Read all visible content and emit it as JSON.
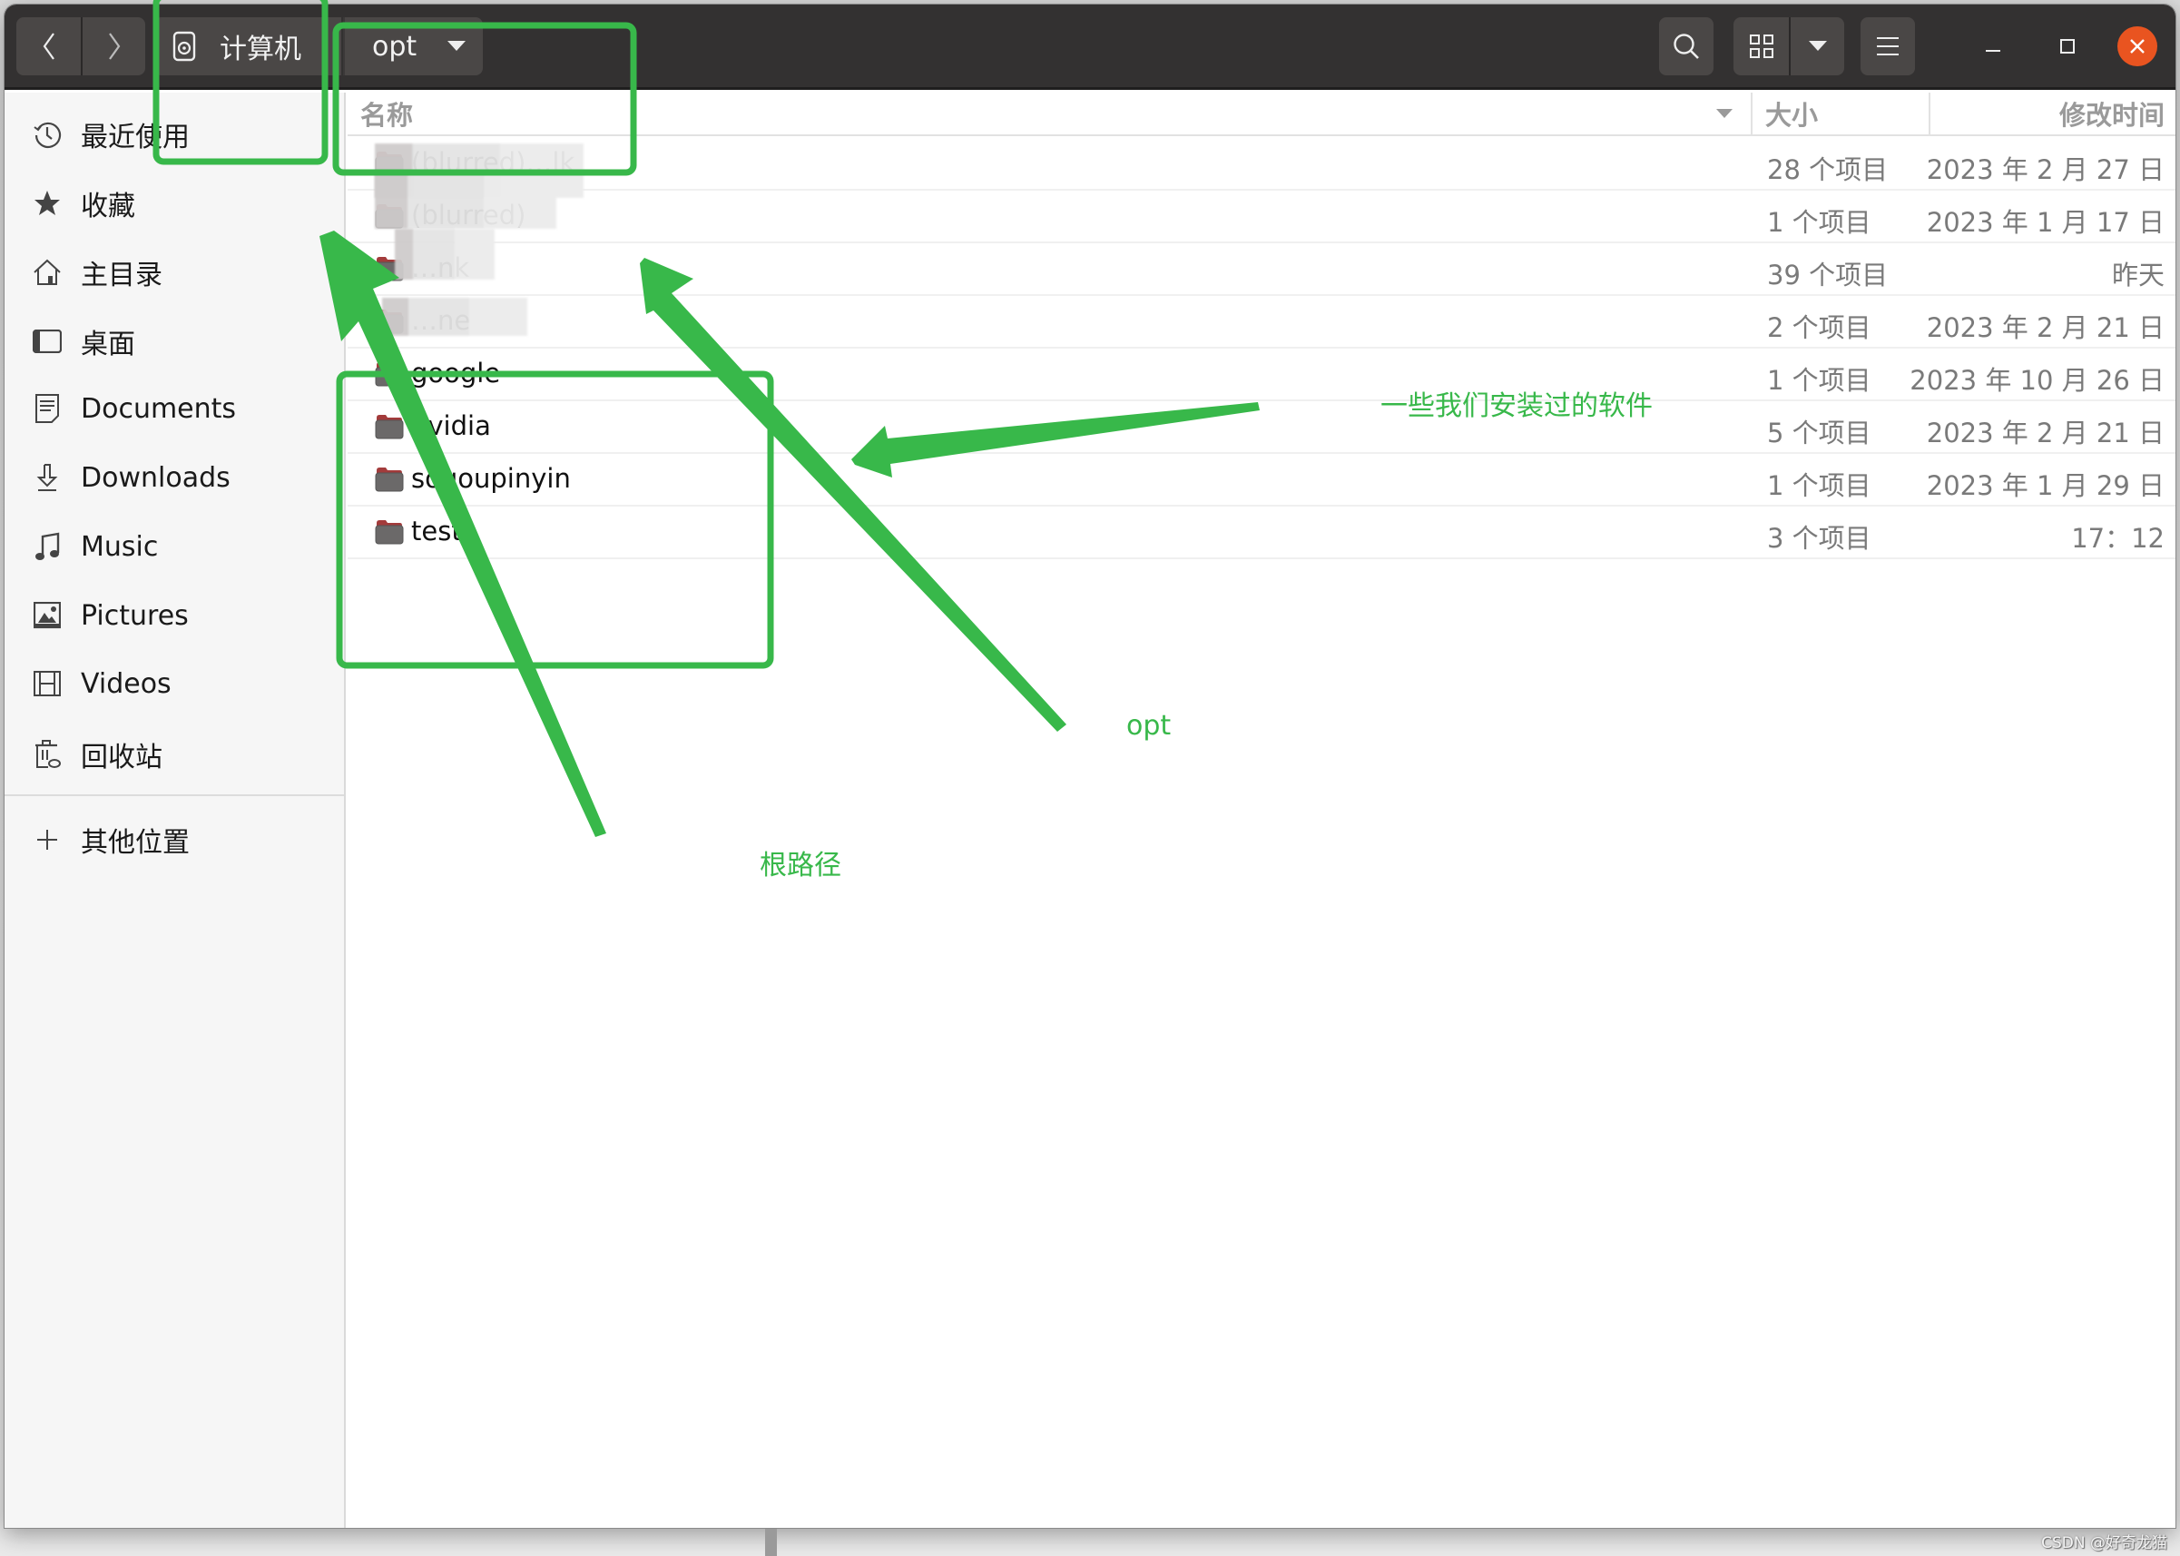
{
  "headerbar": {
    "back_icon": "chevron-left-icon",
    "forward_icon": "chevron-right-icon",
    "path": [
      {
        "label": "计算机",
        "icon": "drive-icon"
      },
      {
        "label": "opt",
        "icon": "dropdown-arrow-icon"
      }
    ],
    "search_icon": "search-icon",
    "view_icon": "grid-view-icon",
    "view_options_icon": "dropdown-arrow-icon",
    "menu_icon": "hamburger-menu-icon",
    "window_controls": [
      "minimize",
      "maximize",
      "close"
    ],
    "close_color": "#e95420"
  },
  "sidebar": {
    "items": [
      {
        "label": "最近使用",
        "icon": "recent-icon"
      },
      {
        "label": "收藏",
        "icon": "star-icon"
      },
      {
        "label": "主目录",
        "icon": "home-icon"
      },
      {
        "label": "桌面",
        "icon": "desktop-icon"
      },
      {
        "label": "Documents",
        "icon": "document-icon"
      },
      {
        "label": "Downloads",
        "icon": "download-icon"
      },
      {
        "label": "Music",
        "icon": "music-icon"
      },
      {
        "label": "Pictures",
        "icon": "picture-icon"
      },
      {
        "label": "Videos",
        "icon": "video-icon"
      },
      {
        "label": "回收站",
        "icon": "trash-icon"
      }
    ],
    "other_locations": {
      "label": "其他位置",
      "icon": "plus-icon"
    }
  },
  "list": {
    "columns": {
      "name": "名称",
      "size": "大小",
      "modified": "修改时间"
    },
    "rows": [
      {
        "name": "(blurred)…lk",
        "size": "28 个项目",
        "modified": "2023 年 2 月 27 日",
        "blurred": true
      },
      {
        "name": "(blurred)",
        "size": "1 个项目",
        "modified": "2023 年 1 月 17 日",
        "blurred": true
      },
      {
        "name": "…nk",
        "size": "39 个项目",
        "modified": "昨天",
        "blurred": true
      },
      {
        "name": "…ne",
        "size": "2 个项目",
        "modified": "2023 年 2 月 21 日",
        "blurred": true
      },
      {
        "name": "google",
        "size": "1 个项目",
        "modified": "2023 年 10 月 26 日"
      },
      {
        "name": "nvidia",
        "size": "5 个项目",
        "modified": "2023 年 2 月 21 日"
      },
      {
        "name": "sogoupinyin",
        "size": "1 个项目",
        "modified": "2023 年 1 月 29 日"
      },
      {
        "name": "test",
        "size": "3 个项目",
        "modified": "17：12"
      }
    ]
  },
  "annotations": {
    "color": "#38b84a",
    "labels": {
      "software": "一些我们安装过的软件",
      "opt": "opt",
      "root": "根路径"
    }
  },
  "watermark": "CSDN @好奇龙猫"
}
